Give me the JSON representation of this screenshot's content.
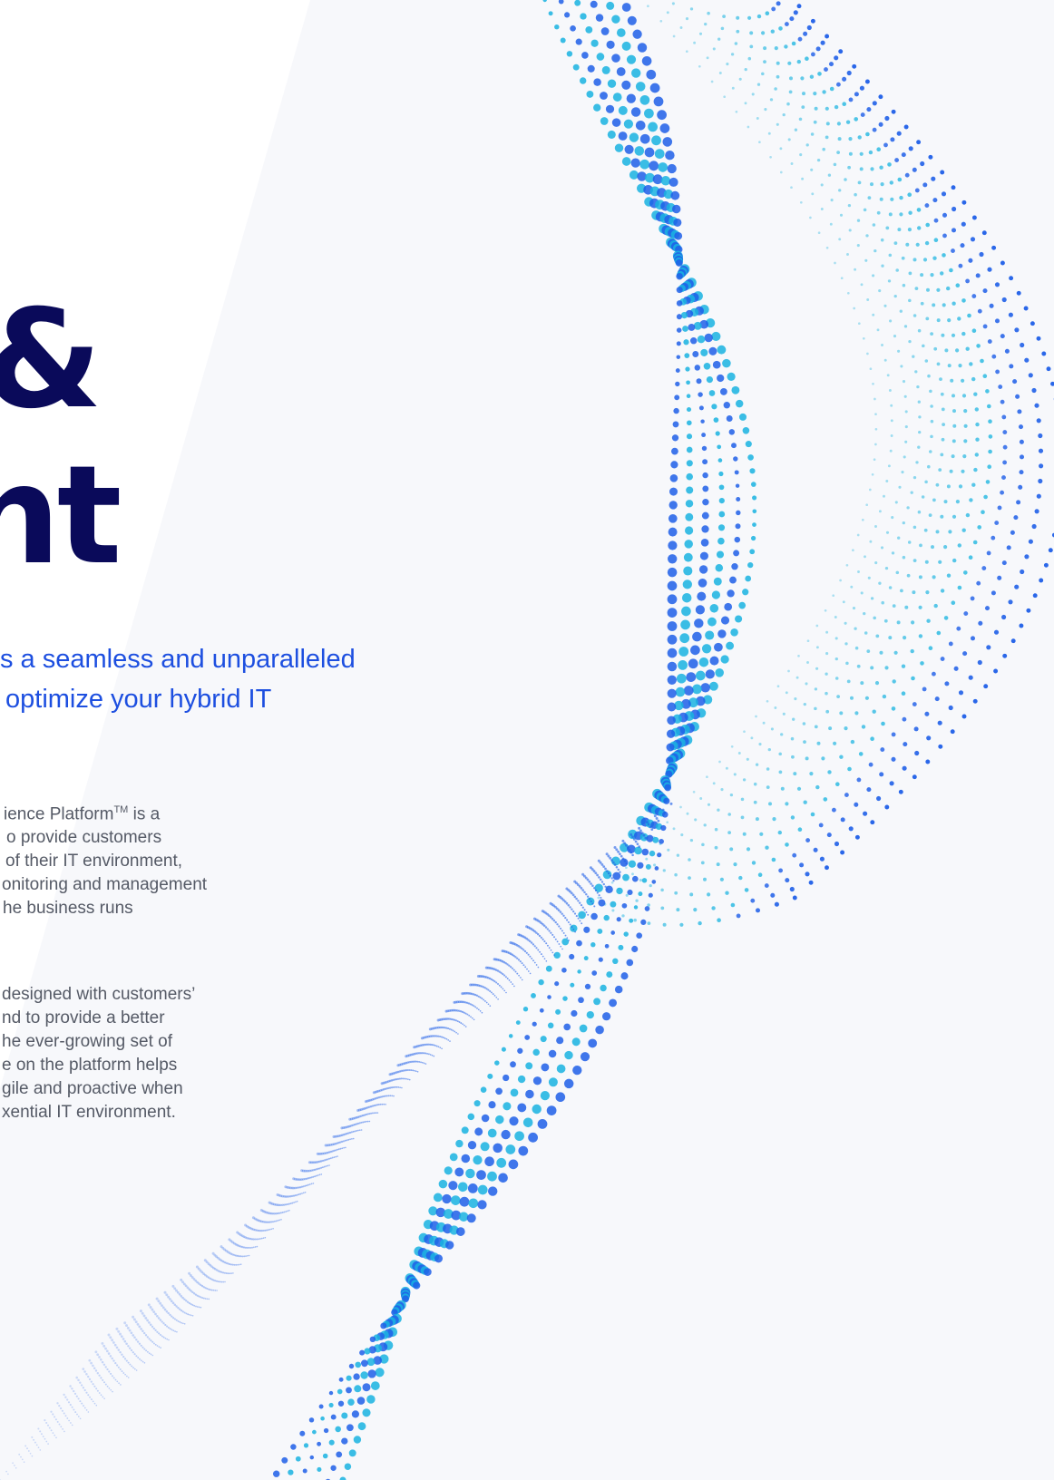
{
  "headline": {
    "line1": "&",
    "line2": "nt"
  },
  "subhead": {
    "lines": [
      "s a seamless and unparalleled",
      "optimize your hybrid IT"
    ]
  },
  "body": {
    "paragraph1": [
      "ience Platform",
      "o provide customers",
      "of their IT environment,",
      "onitoring and management",
      "he business runs"
    ],
    "trademark": "TM",
    "paragraph1_line1_suffix": " is a",
    "paragraph2": [
      "designed with customers’",
      "nd to provide a better",
      "he ever-growing set of",
      "e on the platform helps",
      "gile and proactive when",
      "xential IT environment."
    ]
  },
  "colors": {
    "headline": "#0a0a5a",
    "accent": "#1d4fe0",
    "dots_primary": "#1f5fe8",
    "dots_secondary": "#19b3e0",
    "body_text": "#555a66"
  }
}
